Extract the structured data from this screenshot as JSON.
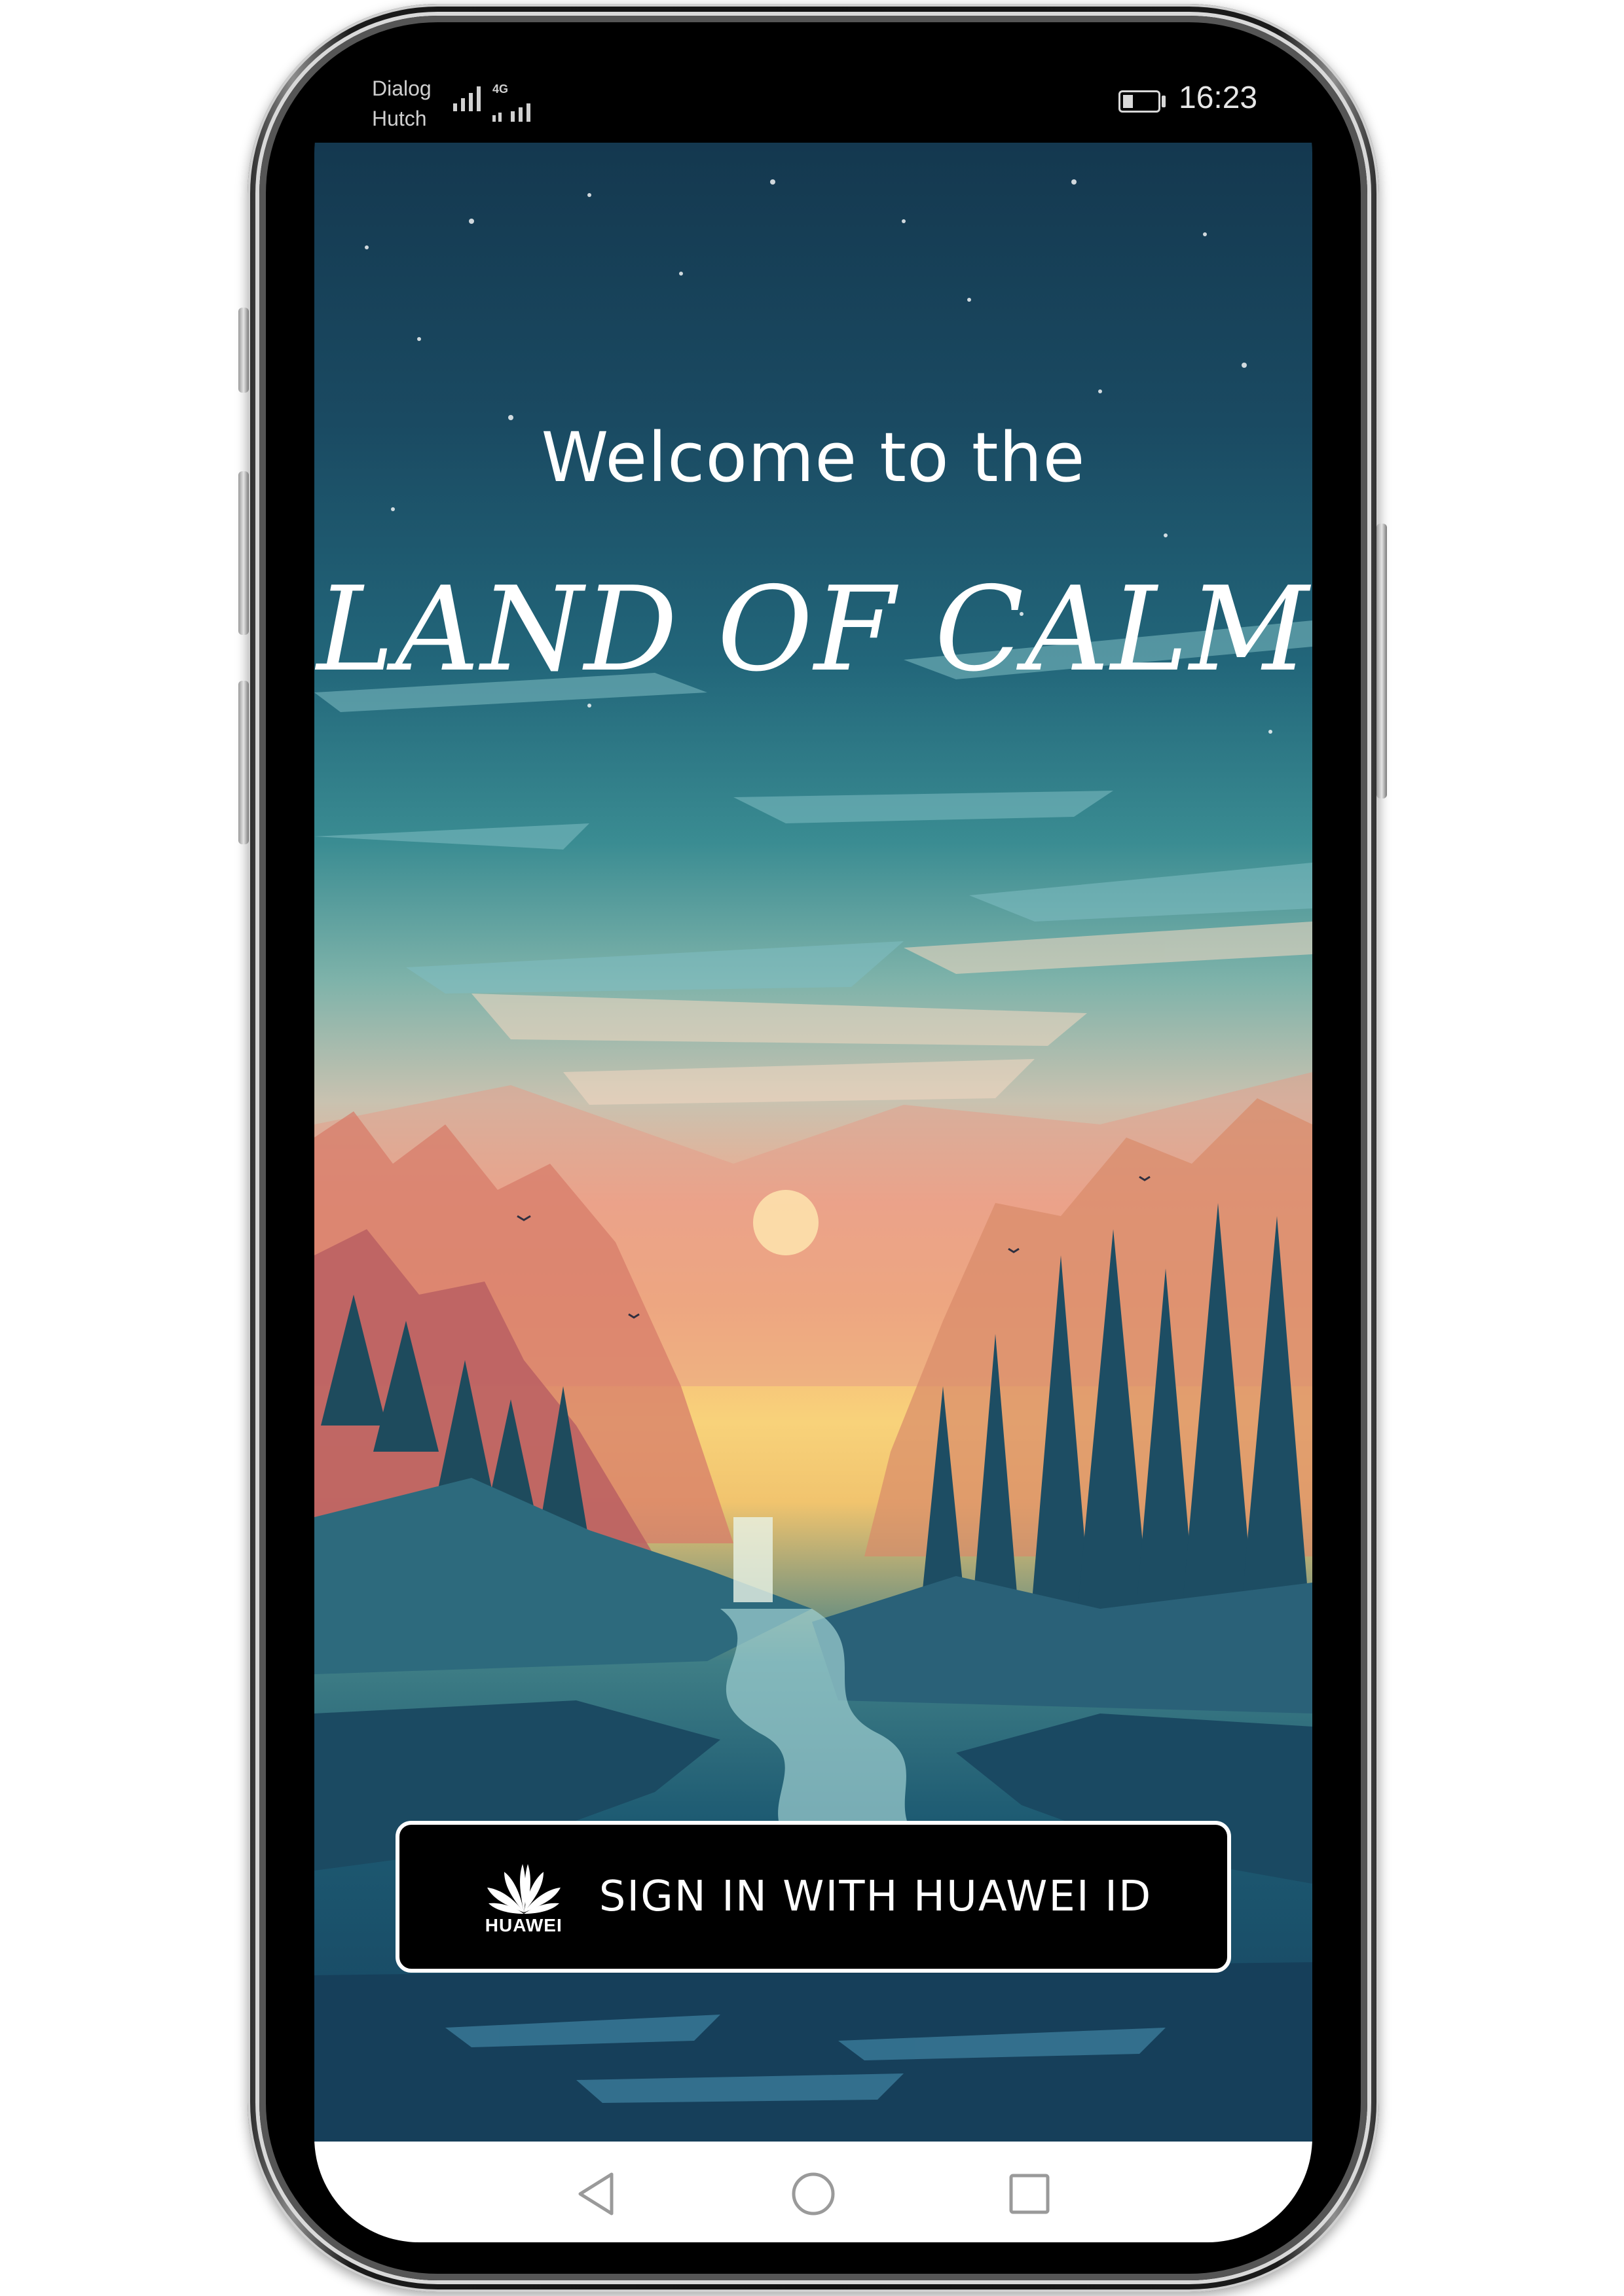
{
  "status_bar": {
    "carrier_line1": "Dialog",
    "carrier_line2": "Hutch",
    "network_label": "4G",
    "time": "16:23",
    "battery_level": 0.3
  },
  "app": {
    "welcome_text": "Welcome to the",
    "title": "LAND OF CALM",
    "sign_in_button": {
      "label": "SIGN IN WITH HUAWEI ID",
      "brand_logo_text": "HUAWEI",
      "icon": "huawei-logo-icon"
    }
  },
  "nav_bar": {
    "back_icon": "back-triangle-icon",
    "home_icon": "home-circle-icon",
    "recents_icon": "recents-square-icon"
  },
  "colors": {
    "sky_top": "#14384f",
    "horizon": "#f8d27a",
    "button_background": "#000000",
    "button_border": "#ffffff",
    "text": "#ffffff"
  }
}
